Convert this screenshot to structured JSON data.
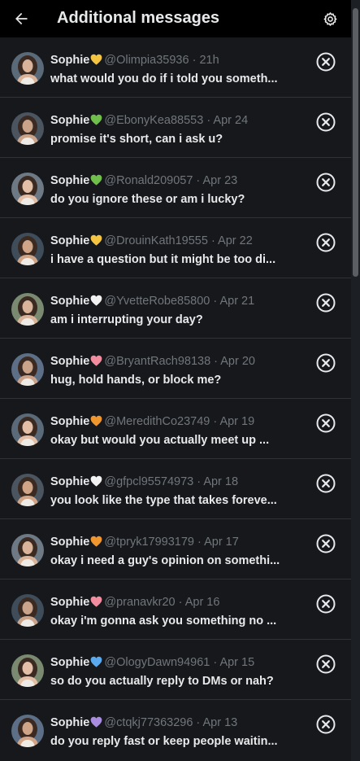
{
  "header": {
    "title": "Additional messages",
    "back_icon": "arrow-left-icon",
    "settings_icon": "gear-icon"
  },
  "colors": {
    "background": "#16181c",
    "header_bg": "#000000",
    "divider": "#2f3336",
    "muted_text": "#71767b",
    "primary_text": "#e7e9ea"
  },
  "messages": [
    {
      "name": "Sophie",
      "heart": "yellow",
      "heart_color": "#f5c542",
      "handle": "@Olimpia35936",
      "time": "21h",
      "preview": "what would you do if i told you someth..."
    },
    {
      "name": "Sophie",
      "heart": "green",
      "heart_color": "#6fbf4a",
      "handle": "@EbonyKea88553",
      "time": "Apr 24",
      "preview": "promise it's short, can i ask u?"
    },
    {
      "name": "Sophie",
      "heart": "green",
      "heart_color": "#6fbf4a",
      "handle": "@Ronald209057",
      "time": "Apr 23",
      "preview": "do you ignore these or am i lucky?"
    },
    {
      "name": "Sophie",
      "heart": "yellow",
      "heart_color": "#f5c542",
      "handle": "@DrouinKath19555",
      "time": "Apr 22",
      "preview": "i have a question but it might be too di..."
    },
    {
      "name": "Sophie",
      "heart": "white",
      "heart_color": "#f2f2f2",
      "handle": "@YvetteRobe85800",
      "time": "Apr 21",
      "preview": "am i interrupting your day?"
    },
    {
      "name": "Sophie",
      "heart": "pink",
      "heart_color": "#f28da0",
      "handle": "@BryantRach98138",
      "time": "Apr 20",
      "preview": "hug, hold hands, or block me?"
    },
    {
      "name": "Sophie",
      "heart": "orange",
      "heart_color": "#f0962e",
      "handle": "@MeredithCo23749",
      "time": "Apr 19",
      "preview": "okay but would you actually meet up ..."
    },
    {
      "name": "Sophie",
      "heart": "white",
      "heart_color": "#f2f2f2",
      "handle": "@gfpcl95574973",
      "time": "Apr 18",
      "preview": "you look like the type that takes foreve..."
    },
    {
      "name": "Sophie",
      "heart": "orange",
      "heart_color": "#f0962e",
      "handle": "@tpryk17993179",
      "time": "Apr 17",
      "preview": "okay i need a guy's opinion on somethi..."
    },
    {
      "name": "Sophie",
      "heart": "pink",
      "heart_color": "#f28da0",
      "handle": "@pranavkr20",
      "time": "Apr 16",
      "preview": "okay i'm gonna ask you something no ..."
    },
    {
      "name": "Sophie",
      "heart": "blue",
      "heart_color": "#5aa9ef",
      "handle": "@OlogyDawn94961",
      "time": "Apr 15",
      "preview": "so do you actually reply to DMs or nah?"
    },
    {
      "name": "Sophie",
      "heart": "purple",
      "heart_color": "#a98bdf",
      "handle": "@ctqkj77363296",
      "time": "Apr 13",
      "preview": "do you reply fast or keep people waitin..."
    }
  ]
}
